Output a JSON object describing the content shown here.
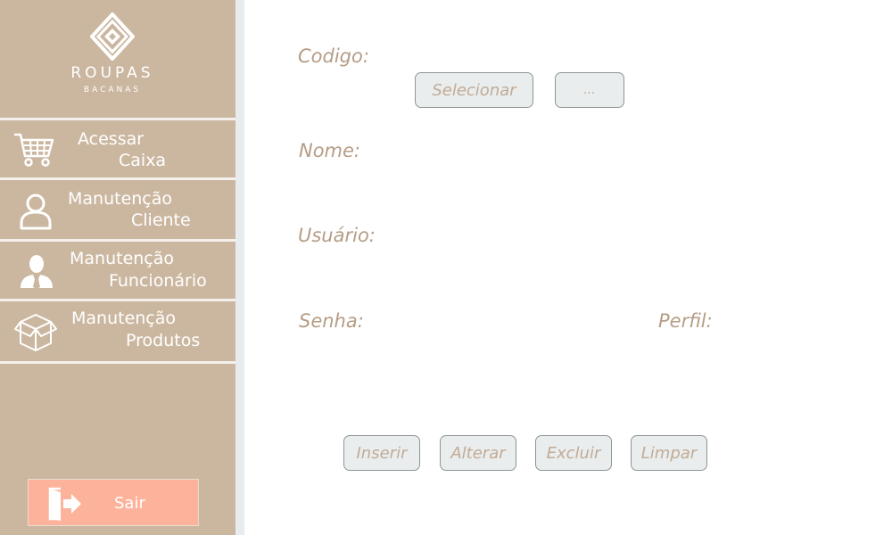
{
  "logo": {
    "brand": "ROUPAS",
    "subtitle": "BACANAS"
  },
  "sidebar": {
    "items": [
      {
        "line1": "Acessar",
        "line2": "Caixa",
        "icon": "shopping-cart-icon"
      },
      {
        "line1": "Manutenção",
        "line2": "Cliente",
        "icon": "user-icon"
      },
      {
        "line1": "Manutenção",
        "line2": "Funcionário",
        "icon": "employee-icon"
      },
      {
        "line1": "Manutenção",
        "line2": "Produtos",
        "icon": "box-icon"
      }
    ],
    "exit_label": "Sair",
    "exit_icon": "logout-door-icon"
  },
  "form": {
    "codigo_label": "Codigo:",
    "nome_label": "Nome:",
    "usuario_label": "Usuário:",
    "senha_label": "Senha:",
    "perfil_label": "Perfil:",
    "select_label": "Selecionar",
    "browse_label": "..."
  },
  "actions": {
    "insert_label": "Inserir",
    "update_label": "Alterar",
    "delete_label": "Excluir",
    "clear_label": "Limpar"
  },
  "colors": {
    "sidebar_bg": "#cbb7a0",
    "exit_bg": "#fdb39b",
    "label_text": "#b59d85",
    "button_bg": "#e9edee"
  }
}
